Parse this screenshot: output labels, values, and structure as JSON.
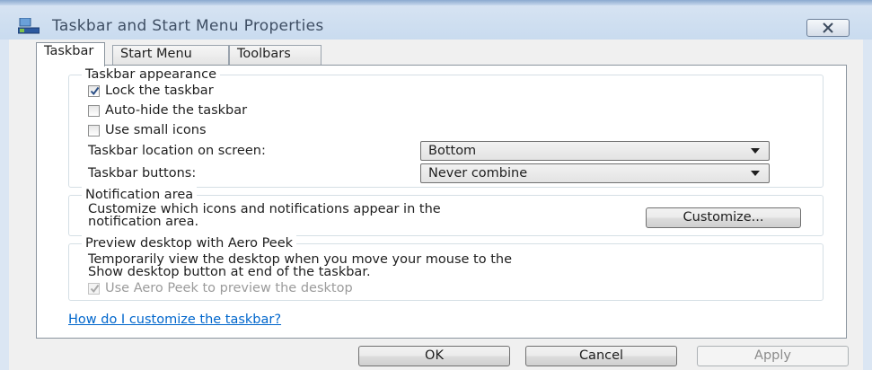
{
  "window": {
    "title": "Taskbar and Start Menu Properties",
    "icon": "taskbar-properties-icon",
    "close_icon": "close-icon"
  },
  "tabs": [
    {
      "label": "Taskbar",
      "active": true
    },
    {
      "label": "Start Menu",
      "active": false
    },
    {
      "label": "Toolbars",
      "active": false
    }
  ],
  "taskbar_appearance": {
    "legend": "Taskbar appearance",
    "lock": {
      "label": "Lock the taskbar",
      "checked": true
    },
    "autohide": {
      "label": "Auto-hide the taskbar",
      "checked": false
    },
    "small_icons": {
      "label": "Use small icons",
      "checked": false
    },
    "location_label": "Taskbar location on screen:",
    "location_value": "Bottom",
    "buttons_label": "Taskbar buttons:",
    "buttons_value": "Never combine"
  },
  "notification_area": {
    "legend": "Notification area",
    "text_line1": "Customize which icons and notifications appear in the",
    "text_line2": "notification area.",
    "customize_button": "Customize..."
  },
  "aero_peek": {
    "legend": "Preview desktop with Aero Peek",
    "text_line1": "Temporarily view the desktop when you move your mouse to the",
    "text_line2": "Show desktop button at end of the taskbar.",
    "checkbox": {
      "label": "Use Aero Peek to preview the desktop",
      "checked": true,
      "disabled": true
    }
  },
  "help_link": "How do I customize the taskbar?",
  "buttons": {
    "ok": "OK",
    "cancel": "Cancel",
    "apply": "Apply"
  },
  "colors": {
    "link": "#0066cc",
    "titlebar": "#c9dbef",
    "dialog_bg": "#f0f0f0"
  }
}
